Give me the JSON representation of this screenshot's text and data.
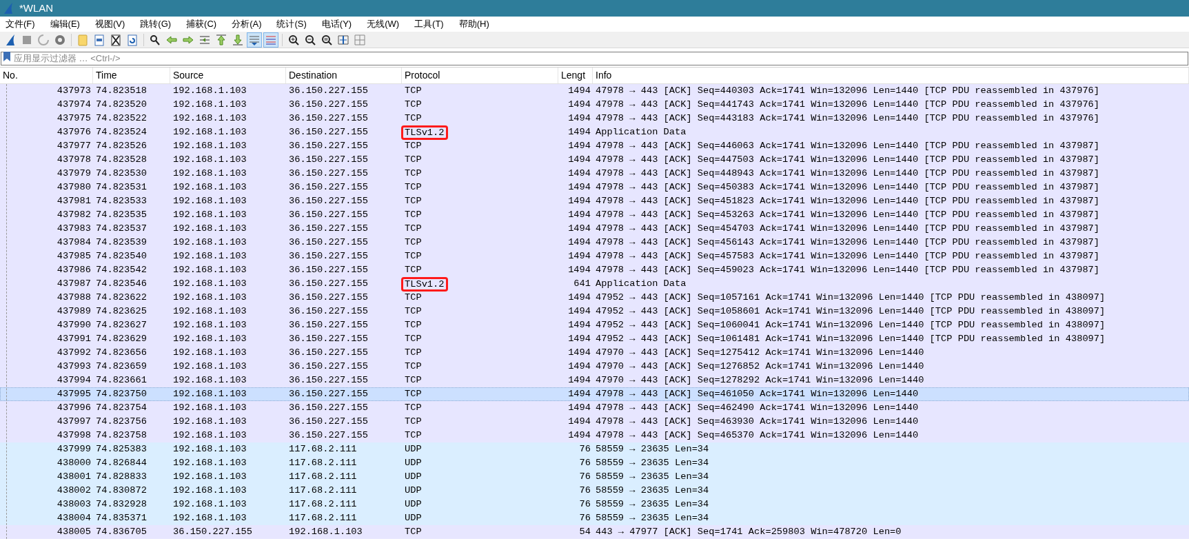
{
  "window": {
    "title": "*WLAN"
  },
  "menu": [
    "文件(F)",
    "编辑(E)",
    "视图(V)",
    "跳转(G)",
    "捕获(C)",
    "分析(A)",
    "统计(S)",
    "电话(Y)",
    "无线(W)",
    "工具(T)",
    "帮助(H)"
  ],
  "toolbar": [
    {
      "on": false
    },
    {
      "on": false
    },
    {
      "on": false
    },
    {
      "on": false
    },
    {
      "on": false
    },
    {
      "on": false
    },
    {
      "on": false
    },
    {
      "on": false
    },
    {
      "on": false
    },
    {
      "on": false
    },
    {
      "on": false
    },
    {
      "on": false
    },
    {
      "on": false
    },
    {
      "on": false
    },
    {
      "on": true
    },
    {
      "on": true
    },
    {
      "on": false
    },
    {
      "on": false
    },
    {
      "on": false
    },
    {
      "on": false
    },
    {
      "on": false
    }
  ],
  "filter": {
    "placeholder": "应用显示过滤器 … <Ctrl-/>"
  },
  "table": {
    "columns": [
      "No.",
      "Time",
      "Source",
      "Destination",
      "Protocol",
      "Lengt",
      "Info"
    ],
    "rows": [
      {
        "no": "437973",
        "time": "74.823518",
        "source": "192.168.1.103",
        "destination": "36.150.227.155",
        "protocol": "TCP",
        "length": "1494",
        "info": "47978 → 443 [ACK] Seq=440303 Ack=1741 Win=132096 Len=1440 [TCP PDU reassembled in 437976]",
        "color": "#e7e6ff",
        "selected": false,
        "boxed": false
      },
      {
        "no": "437974",
        "time": "74.823520",
        "source": "192.168.1.103",
        "destination": "36.150.227.155",
        "protocol": "TCP",
        "length": "1494",
        "info": "47978 → 443 [ACK] Seq=441743 Ack=1741 Win=132096 Len=1440 [TCP PDU reassembled in 437976]",
        "color": "#e7e6ff",
        "selected": false,
        "boxed": false
      },
      {
        "no": "437975",
        "time": "74.823522",
        "source": "192.168.1.103",
        "destination": "36.150.227.155",
        "protocol": "TCP",
        "length": "1494",
        "info": "47978 → 443 [ACK] Seq=443183 Ack=1741 Win=132096 Len=1440 [TCP PDU reassembled in 437976]",
        "color": "#e7e6ff",
        "selected": false,
        "boxed": false
      },
      {
        "no": "437976",
        "time": "74.823524",
        "source": "192.168.1.103",
        "destination": "36.150.227.155",
        "protocol": "TLSv1.2",
        "length": "1494",
        "info": "Application Data",
        "color": "#e7e6ff",
        "selected": false,
        "boxed": true
      },
      {
        "no": "437977",
        "time": "74.823526",
        "source": "192.168.1.103",
        "destination": "36.150.227.155",
        "protocol": "TCP",
        "length": "1494",
        "info": "47978 → 443 [ACK] Seq=446063 Ack=1741 Win=132096 Len=1440 [TCP PDU reassembled in 437987]",
        "color": "#e7e6ff",
        "selected": false,
        "boxed": false
      },
      {
        "no": "437978",
        "time": "74.823528",
        "source": "192.168.1.103",
        "destination": "36.150.227.155",
        "protocol": "TCP",
        "length": "1494",
        "info": "47978 → 443 [ACK] Seq=447503 Ack=1741 Win=132096 Len=1440 [TCP PDU reassembled in 437987]",
        "color": "#e7e6ff",
        "selected": false,
        "boxed": false
      },
      {
        "no": "437979",
        "time": "74.823530",
        "source": "192.168.1.103",
        "destination": "36.150.227.155",
        "protocol": "TCP",
        "length": "1494",
        "info": "47978 → 443 [ACK] Seq=448943 Ack=1741 Win=132096 Len=1440 [TCP PDU reassembled in 437987]",
        "color": "#e7e6ff",
        "selected": false,
        "boxed": false
      },
      {
        "no": "437980",
        "time": "74.823531",
        "source": "192.168.1.103",
        "destination": "36.150.227.155",
        "protocol": "TCP",
        "length": "1494",
        "info": "47978 → 443 [ACK] Seq=450383 Ack=1741 Win=132096 Len=1440 [TCP PDU reassembled in 437987]",
        "color": "#e7e6ff",
        "selected": false,
        "boxed": false
      },
      {
        "no": "437981",
        "time": "74.823533",
        "source": "192.168.1.103",
        "destination": "36.150.227.155",
        "protocol": "TCP",
        "length": "1494",
        "info": "47978 → 443 [ACK] Seq=451823 Ack=1741 Win=132096 Len=1440 [TCP PDU reassembled in 437987]",
        "color": "#e7e6ff",
        "selected": false,
        "boxed": false
      },
      {
        "no": "437982",
        "time": "74.823535",
        "source": "192.168.1.103",
        "destination": "36.150.227.155",
        "protocol": "TCP",
        "length": "1494",
        "info": "47978 → 443 [ACK] Seq=453263 Ack=1741 Win=132096 Len=1440 [TCP PDU reassembled in 437987]",
        "color": "#e7e6ff",
        "selected": false,
        "boxed": false
      },
      {
        "no": "437983",
        "time": "74.823537",
        "source": "192.168.1.103",
        "destination": "36.150.227.155",
        "protocol": "TCP",
        "length": "1494",
        "info": "47978 → 443 [ACK] Seq=454703 Ack=1741 Win=132096 Len=1440 [TCP PDU reassembled in 437987]",
        "color": "#e7e6ff",
        "selected": false,
        "boxed": false
      },
      {
        "no": "437984",
        "time": "74.823539",
        "source": "192.168.1.103",
        "destination": "36.150.227.155",
        "protocol": "TCP",
        "length": "1494",
        "info": "47978 → 443 [ACK] Seq=456143 Ack=1741 Win=132096 Len=1440 [TCP PDU reassembled in 437987]",
        "color": "#e7e6ff",
        "selected": false,
        "boxed": false
      },
      {
        "no": "437985",
        "time": "74.823540",
        "source": "192.168.1.103",
        "destination": "36.150.227.155",
        "protocol": "TCP",
        "length": "1494",
        "info": "47978 → 443 [ACK] Seq=457583 Ack=1741 Win=132096 Len=1440 [TCP PDU reassembled in 437987]",
        "color": "#e7e6ff",
        "selected": false,
        "boxed": false
      },
      {
        "no": "437986",
        "time": "74.823542",
        "source": "192.168.1.103",
        "destination": "36.150.227.155",
        "protocol": "TCP",
        "length": "1494",
        "info": "47978 → 443 [ACK] Seq=459023 Ack=1741 Win=132096 Len=1440 [TCP PDU reassembled in 437987]",
        "color": "#e7e6ff",
        "selected": false,
        "boxed": false
      },
      {
        "no": "437987",
        "time": "74.823546",
        "source": "192.168.1.103",
        "destination": "36.150.227.155",
        "protocol": "TLSv1.2",
        "length": "641",
        "info": "Application Data",
        "color": "#e7e6ff",
        "selected": false,
        "boxed": true
      },
      {
        "no": "437988",
        "time": "74.823622",
        "source": "192.168.1.103",
        "destination": "36.150.227.155",
        "protocol": "TCP",
        "length": "1494",
        "info": "47952 → 443 [ACK] Seq=1057161 Ack=1741 Win=132096 Len=1440 [TCP PDU reassembled in 438097]",
        "color": "#e7e6ff",
        "selected": false,
        "boxed": false
      },
      {
        "no": "437989",
        "time": "74.823625",
        "source": "192.168.1.103",
        "destination": "36.150.227.155",
        "protocol": "TCP",
        "length": "1494",
        "info": "47952 → 443 [ACK] Seq=1058601 Ack=1741 Win=132096 Len=1440 [TCP PDU reassembled in 438097]",
        "color": "#e7e6ff",
        "selected": false,
        "boxed": false
      },
      {
        "no": "437990",
        "time": "74.823627",
        "source": "192.168.1.103",
        "destination": "36.150.227.155",
        "protocol": "TCP",
        "length": "1494",
        "info": "47952 → 443 [ACK] Seq=1060041 Ack=1741 Win=132096 Len=1440 [TCP PDU reassembled in 438097]",
        "color": "#e7e6ff",
        "selected": false,
        "boxed": false
      },
      {
        "no": "437991",
        "time": "74.823629",
        "source": "192.168.1.103",
        "destination": "36.150.227.155",
        "protocol": "TCP",
        "length": "1494",
        "info": "47952 → 443 [ACK] Seq=1061481 Ack=1741 Win=132096 Len=1440 [TCP PDU reassembled in 438097]",
        "color": "#e7e6ff",
        "selected": false,
        "boxed": false
      },
      {
        "no": "437992",
        "time": "74.823656",
        "source": "192.168.1.103",
        "destination": "36.150.227.155",
        "protocol": "TCP",
        "length": "1494",
        "info": "47970 → 443 [ACK] Seq=1275412 Ack=1741 Win=132096 Len=1440",
        "color": "#e7e6ff",
        "selected": false,
        "boxed": false
      },
      {
        "no": "437993",
        "time": "74.823659",
        "source": "192.168.1.103",
        "destination": "36.150.227.155",
        "protocol": "TCP",
        "length": "1494",
        "info": "47970 → 443 [ACK] Seq=1276852 Ack=1741 Win=132096 Len=1440",
        "color": "#e7e6ff",
        "selected": false,
        "boxed": false
      },
      {
        "no": "437994",
        "time": "74.823661",
        "source": "192.168.1.103",
        "destination": "36.150.227.155",
        "protocol": "TCP",
        "length": "1494",
        "info": "47970 → 443 [ACK] Seq=1278292 Ack=1741 Win=132096 Len=1440",
        "color": "#e7e6ff",
        "selected": false,
        "boxed": false
      },
      {
        "no": "437995",
        "time": "74.823750",
        "source": "192.168.1.103",
        "destination": "36.150.227.155",
        "protocol": "TCP",
        "length": "1494",
        "info": "47978 → 443 [ACK] Seq=461050 Ack=1741 Win=132096 Len=1440",
        "color": "#cce0ff",
        "selected": true,
        "boxed": false
      },
      {
        "no": "437996",
        "time": "74.823754",
        "source": "192.168.1.103",
        "destination": "36.150.227.155",
        "protocol": "TCP",
        "length": "1494",
        "info": "47978 → 443 [ACK] Seq=462490 Ack=1741 Win=132096 Len=1440",
        "color": "#e7e6ff",
        "selected": false,
        "boxed": false
      },
      {
        "no": "437997",
        "time": "74.823756",
        "source": "192.168.1.103",
        "destination": "36.150.227.155",
        "protocol": "TCP",
        "length": "1494",
        "info": "47978 → 443 [ACK] Seq=463930 Ack=1741 Win=132096 Len=1440",
        "color": "#e7e6ff",
        "selected": false,
        "boxed": false
      },
      {
        "no": "437998",
        "time": "74.823758",
        "source": "192.168.1.103",
        "destination": "36.150.227.155",
        "protocol": "TCP",
        "length": "1494",
        "info": "47978 → 443 [ACK] Seq=465370 Ack=1741 Win=132096 Len=1440",
        "color": "#e7e6ff",
        "selected": false,
        "boxed": false
      },
      {
        "no": "437999",
        "time": "74.825383",
        "source": "192.168.1.103",
        "destination": "117.68.2.111",
        "protocol": "UDP",
        "length": "76",
        "info": "58559 → 23635 Len=34",
        "color": "#daeeff",
        "selected": false,
        "boxed": false
      },
      {
        "no": "438000",
        "time": "74.826844",
        "source": "192.168.1.103",
        "destination": "117.68.2.111",
        "protocol": "UDP",
        "length": "76",
        "info": "58559 → 23635 Len=34",
        "color": "#daeeff",
        "selected": false,
        "boxed": false
      },
      {
        "no": "438001",
        "time": "74.828833",
        "source": "192.168.1.103",
        "destination": "117.68.2.111",
        "protocol": "UDP",
        "length": "76",
        "info": "58559 → 23635 Len=34",
        "color": "#daeeff",
        "selected": false,
        "boxed": false
      },
      {
        "no": "438002",
        "time": "74.830872",
        "source": "192.168.1.103",
        "destination": "117.68.2.111",
        "protocol": "UDP",
        "length": "76",
        "info": "58559 → 23635 Len=34",
        "color": "#daeeff",
        "selected": false,
        "boxed": false
      },
      {
        "no": "438003",
        "time": "74.832928",
        "source": "192.168.1.103",
        "destination": "117.68.2.111",
        "protocol": "UDP",
        "length": "76",
        "info": "58559 → 23635 Len=34",
        "color": "#daeeff",
        "selected": false,
        "boxed": false
      },
      {
        "no": "438004",
        "time": "74.835371",
        "source": "192.168.1.103",
        "destination": "117.68.2.111",
        "protocol": "UDP",
        "length": "76",
        "info": "58559 → 23635 Len=34",
        "color": "#daeeff",
        "selected": false,
        "boxed": false
      },
      {
        "no": "438005",
        "time": "74.836705",
        "source": "36.150.227.155",
        "destination": "192.168.1.103",
        "protocol": "TCP",
        "length": "54",
        "info": "443 → 47977 [ACK] Seq=1741 Ack=259803 Win=478720 Len=0",
        "color": "#e7e6ff",
        "selected": false,
        "boxed": false
      }
    ]
  }
}
